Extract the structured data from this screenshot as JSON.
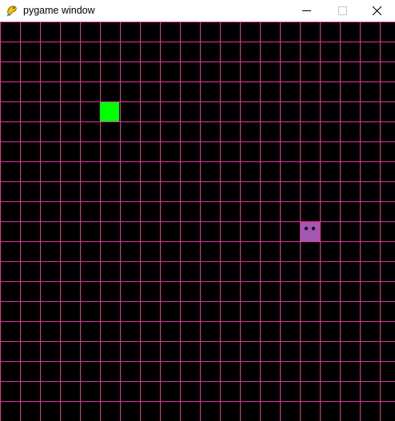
{
  "window": {
    "title": "pygame window",
    "app_icon": "pygame-snake-icon",
    "controls": [
      "minimize-icon",
      "maximize-icon",
      "close-icon"
    ]
  },
  "game": {
    "board": {
      "columns": 20,
      "rows": 20
    },
    "colors": {
      "background": "#000000",
      "grid": "#e0389a",
      "food": "#00ff00",
      "snake": "#a05ab4",
      "snake_eyes": "#1a001f",
      "titlebar": "#ffffff"
    },
    "food": {
      "col": 5,
      "row": 4
    },
    "snake": {
      "segments": [
        {
          "col": 15,
          "row": 10
        }
      ]
    }
  }
}
